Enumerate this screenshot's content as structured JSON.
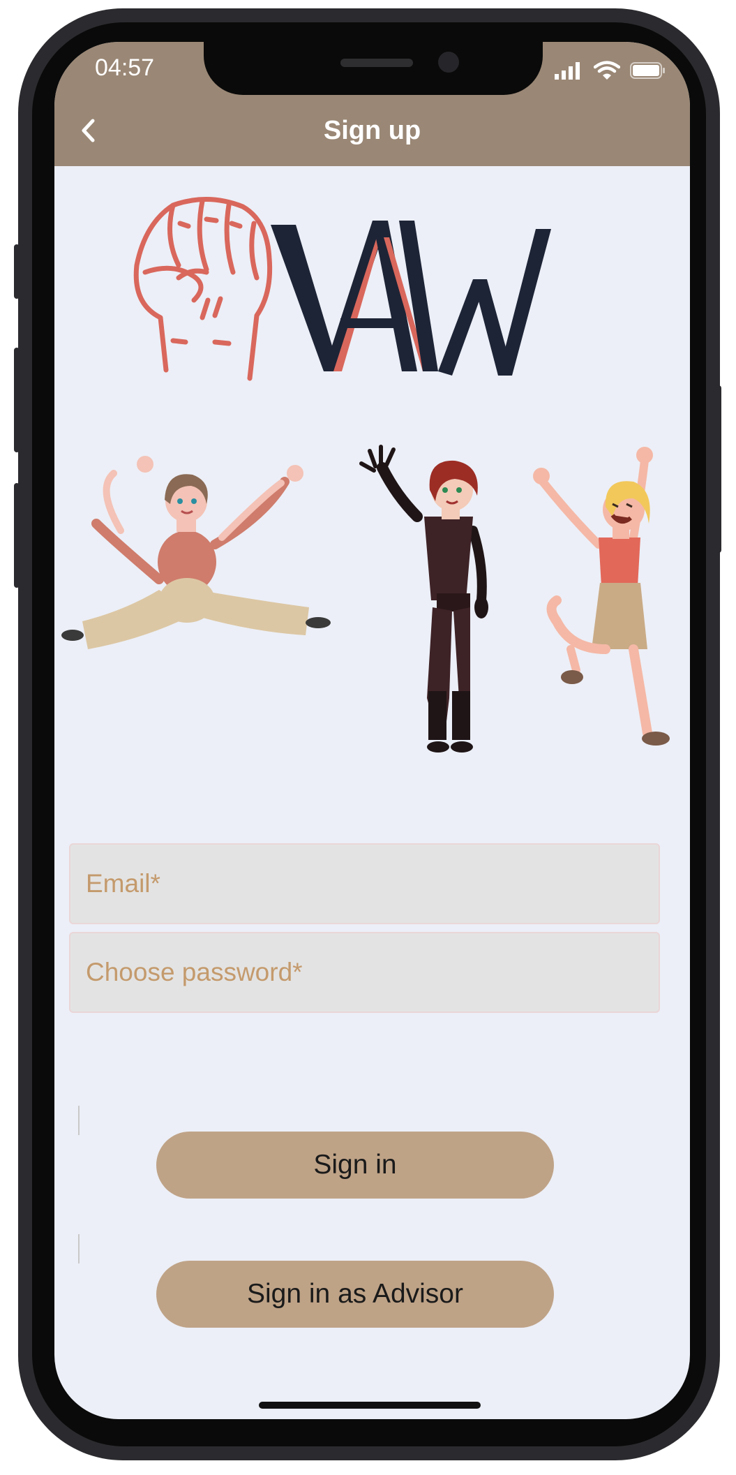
{
  "status_bar": {
    "time": "04:57"
  },
  "nav": {
    "title": "Sign up",
    "back_icon": "chevron-left-icon"
  },
  "logo": {
    "text": "VAW",
    "brand_dark": "#1d2436",
    "brand_red": "#d9675c"
  },
  "form": {
    "email_placeholder": "Email*",
    "password_placeholder": "Choose password*"
  },
  "buttons": {
    "sign_in": "Sign in",
    "sign_in_advisor": "Sign in as Advisor"
  },
  "colors": {
    "nav_bar": "#9a8775",
    "background": "#eceff7",
    "button": "#bfa387",
    "placeholder_text": "#c49a6c"
  }
}
